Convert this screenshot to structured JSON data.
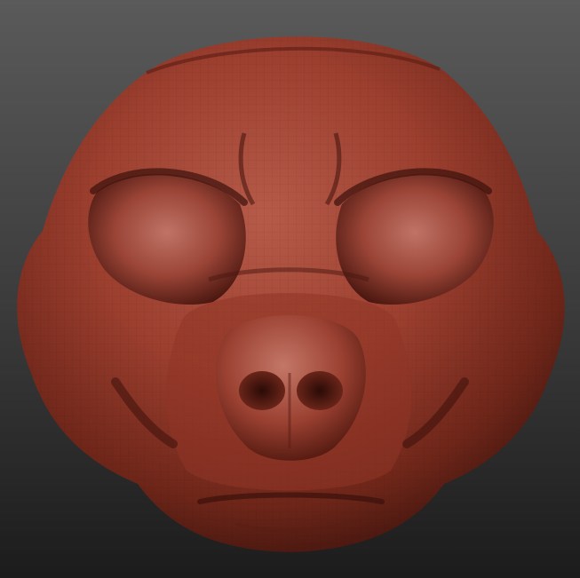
{
  "scene": {
    "subject": "sculpted-head-model",
    "material_color": "#9c3f2f",
    "highlight_color": "#c98070",
    "shadow_color": "#3d130d",
    "background_top": "#5a5a5a",
    "background_bottom": "#1c1c1c"
  }
}
